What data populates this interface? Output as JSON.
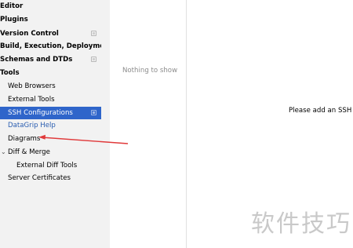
{
  "sidebar": {
    "items": [
      {
        "label": "Editor"
      },
      {
        "label": "Plugins"
      },
      {
        "label": "Version Control"
      },
      {
        "label": "Build, Execution, Deployment"
      },
      {
        "label": "Schemas and DTDs"
      },
      {
        "label": "Tools"
      },
      {
        "label": "Web Browsers"
      },
      {
        "label": "External Tools"
      },
      {
        "label": "SSH Configurations"
      },
      {
        "label": "DataGrip Help"
      },
      {
        "label": "Diagrams"
      },
      {
        "label": "Diff & Merge"
      },
      {
        "label": "External Diff Tools"
      },
      {
        "label": "Server Certificates"
      }
    ],
    "chevron": "⌄"
  },
  "list_panel": {
    "empty_text": "Nothing to show"
  },
  "detail_panel": {
    "message": "Please add an SSH co"
  },
  "watermark": {
    "text": "软件技巧"
  },
  "colors": {
    "selection": "#2f65ca",
    "link": "#2a5db0",
    "arrow": "#e0393a"
  }
}
